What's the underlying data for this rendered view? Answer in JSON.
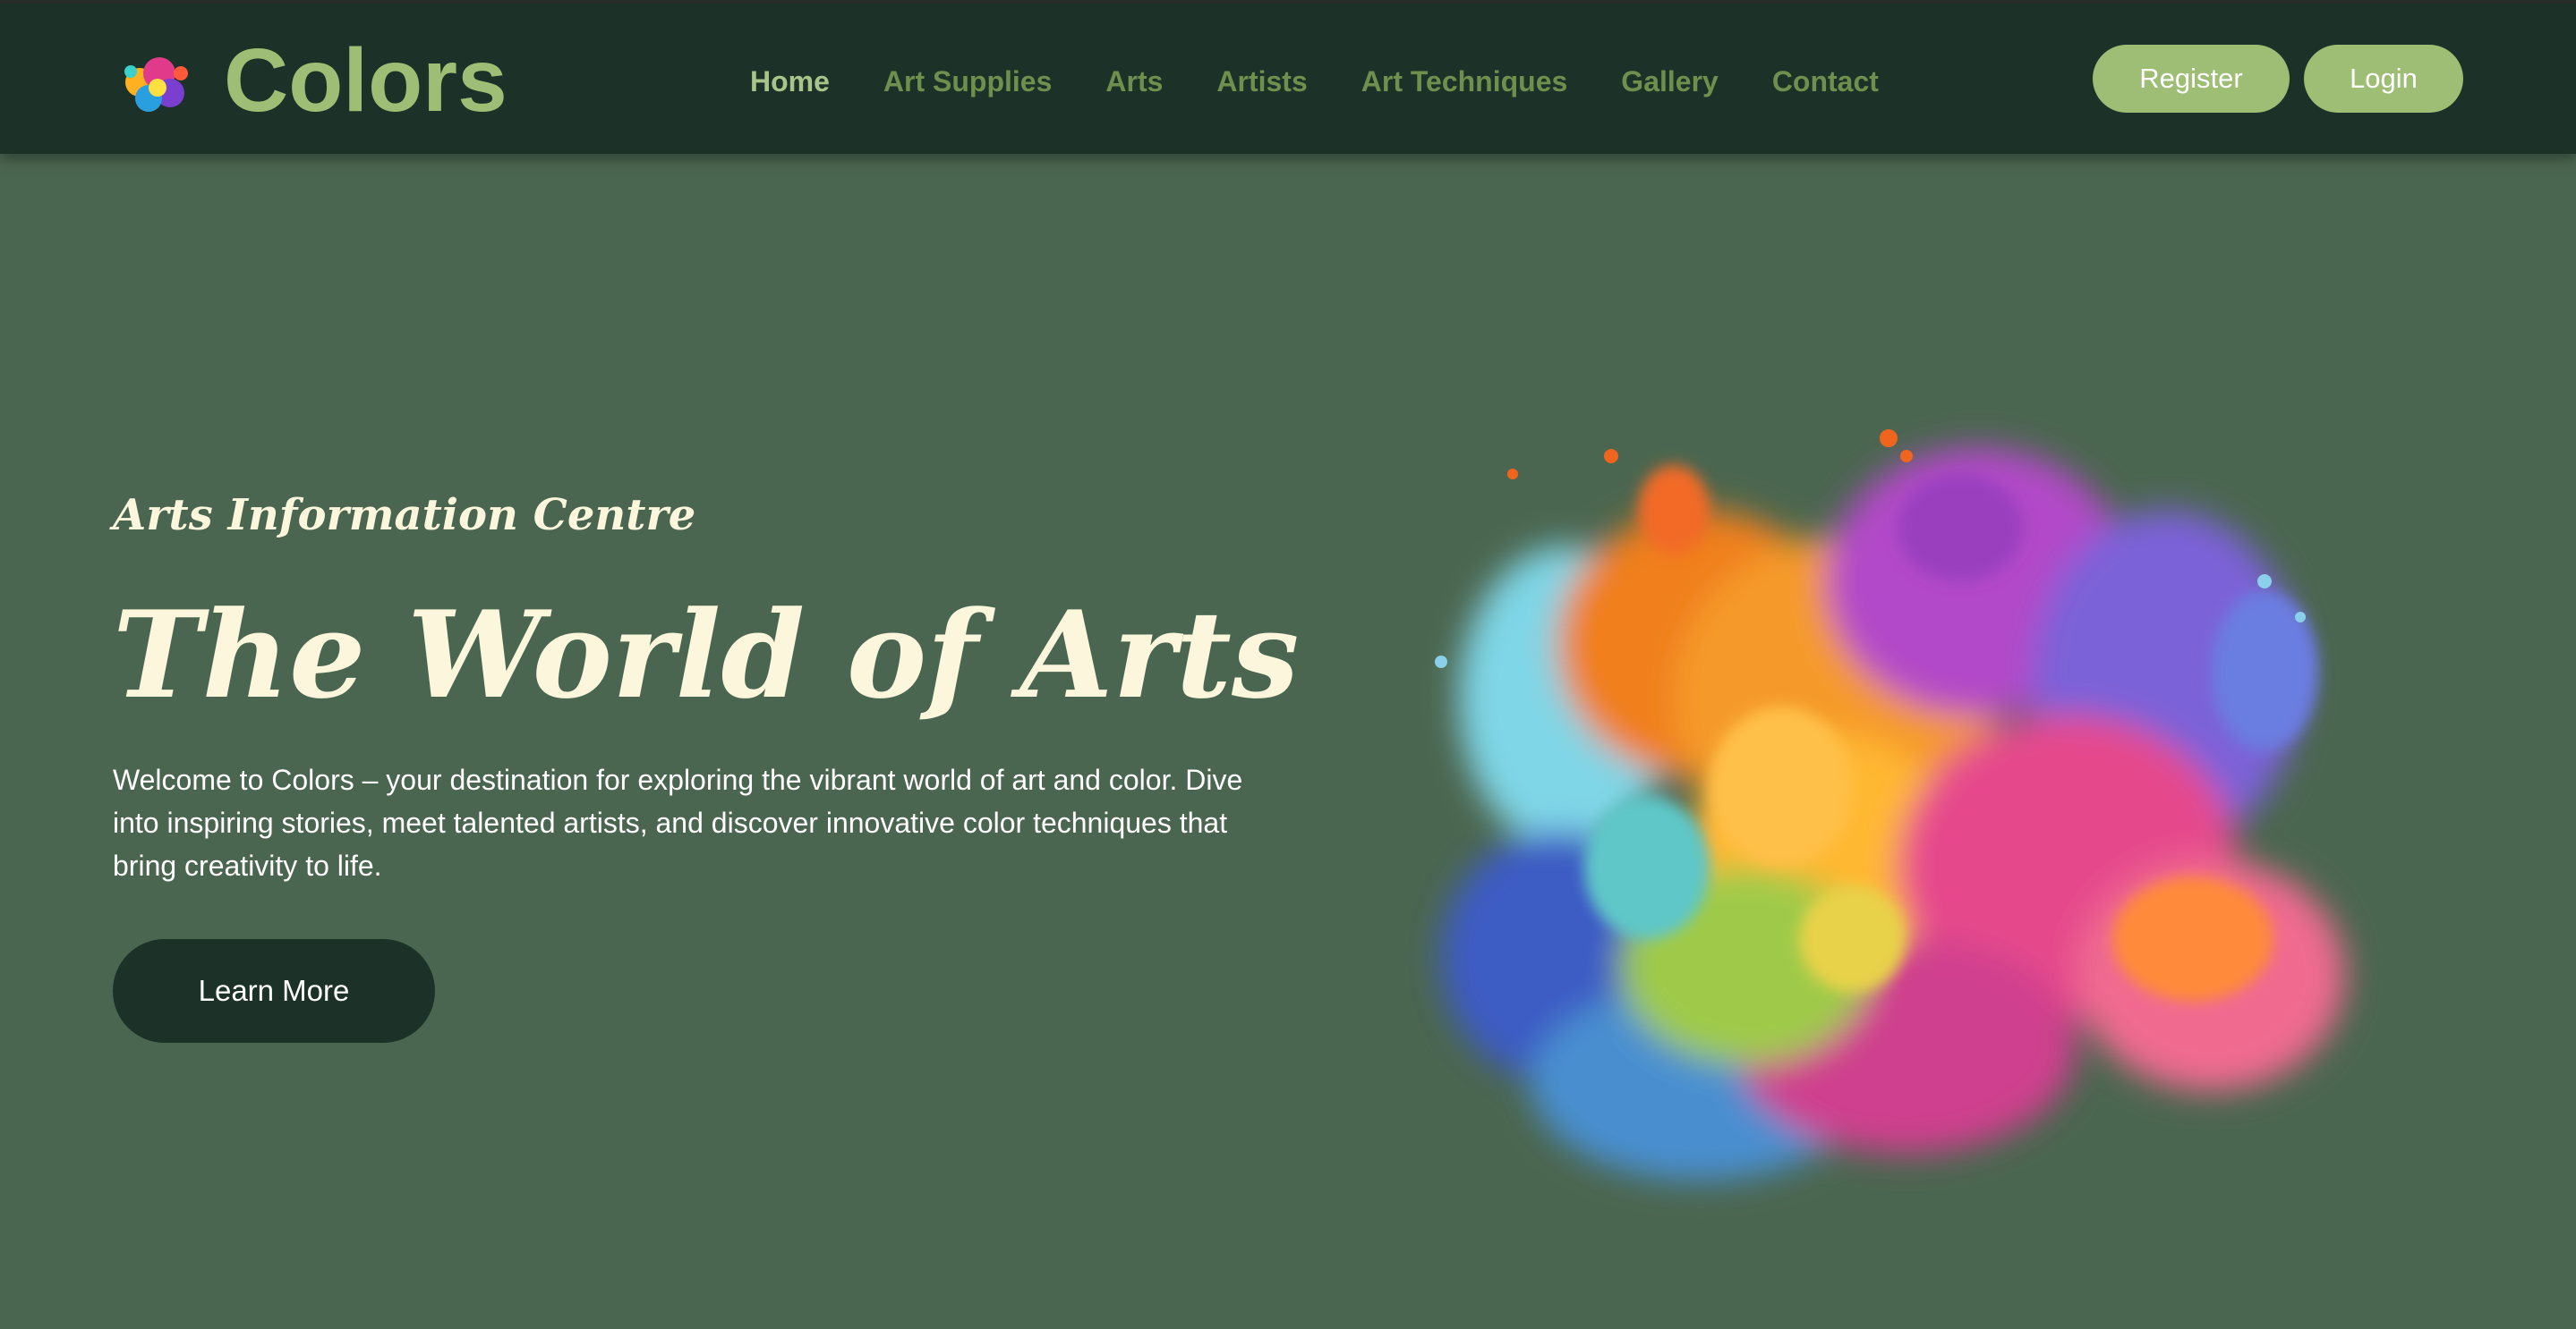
{
  "brand": {
    "name": "Colors",
    "logo_icon": "paint-splash-icon"
  },
  "nav": {
    "items": [
      {
        "label": "Home",
        "active": true
      },
      {
        "label": "Art Supplies",
        "active": false
      },
      {
        "label": "Arts",
        "active": false
      },
      {
        "label": "Artists",
        "active": false
      },
      {
        "label": "Art Techniques",
        "active": false
      },
      {
        "label": "Gallery",
        "active": false
      },
      {
        "label": "Contact",
        "active": false
      }
    ]
  },
  "auth": {
    "register_label": "Register",
    "login_label": "Login"
  },
  "hero": {
    "eyebrow": "Arts Information Centre",
    "title": "The World of Arts",
    "description": "Welcome to Colors – your destination for exploring the vibrant world of art and color. Dive into inspiring stories, meet talented artists, and discover innovative color techniques that bring creativity to life.",
    "cta_label": "Learn More",
    "image": "color-ink-splash-image"
  },
  "colors": {
    "header_bg": "#1c3127",
    "page_bg": "#4b6650",
    "accent": "#9dbe74",
    "nav_text": "#6f8f4e",
    "heading_text": "#fbf6dc"
  }
}
